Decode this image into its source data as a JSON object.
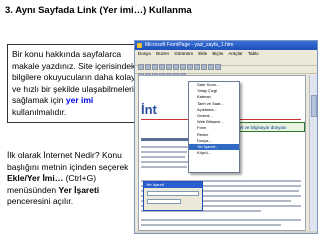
{
  "slide": {
    "title": "3. Aynı Sayfada Link (Yer imi…) Kullanma",
    "intro_lines": [
      "Bir konu hakkında sayfalarca",
      "makale yazdınız. Site içerisindeki",
      "bilgilere okuyucuların daha kolay",
      "ve hızlı bir şekilde ulaşabilmelerini",
      "sağlamak için "
    ],
    "intro_highlight": "yer imi",
    "intro_tail": "kullanılmalıdır.",
    "howto_line1": "İlk olarak İnternet Nedir? Konu",
    "howto_line2": "başlığını metnin içinden seçerek",
    "howto_line3_bold": "Ekle/Yer İmi…",
    "howto_line3_rest": " (Ctrl+G)",
    "howto_line4_pre": "menüsünden ",
    "howto_line4_bold": "Yer İşareti",
    "howto_line5": "penceresini açılır."
  },
  "screenshot": {
    "window_title": "Microsoft FrontPage - yazi_sayfa_1.htm",
    "menubar": [
      "Dosya",
      "Düzen",
      "Görünüm",
      "Ekle",
      "Biçim",
      "Araçlar",
      "Tablo"
    ],
    "doc_heading": "İnt",
    "green_box_text": "İnternet ve bilgisayar dünyası",
    "insert_menu": [
      "Satır Sonu...",
      "Yatay Çizgi",
      "Katman",
      "Tarih ve Saat...",
      "Açıklama...",
      "Gezinti...",
      "Web Bileşeni...",
      "Form",
      "Resim",
      "Dosya...",
      "Yer İşareti...",
      "Köprü..."
    ],
    "active_menu_item": "Yer İşareti...",
    "dialog_title": "Yer İşareti"
  }
}
